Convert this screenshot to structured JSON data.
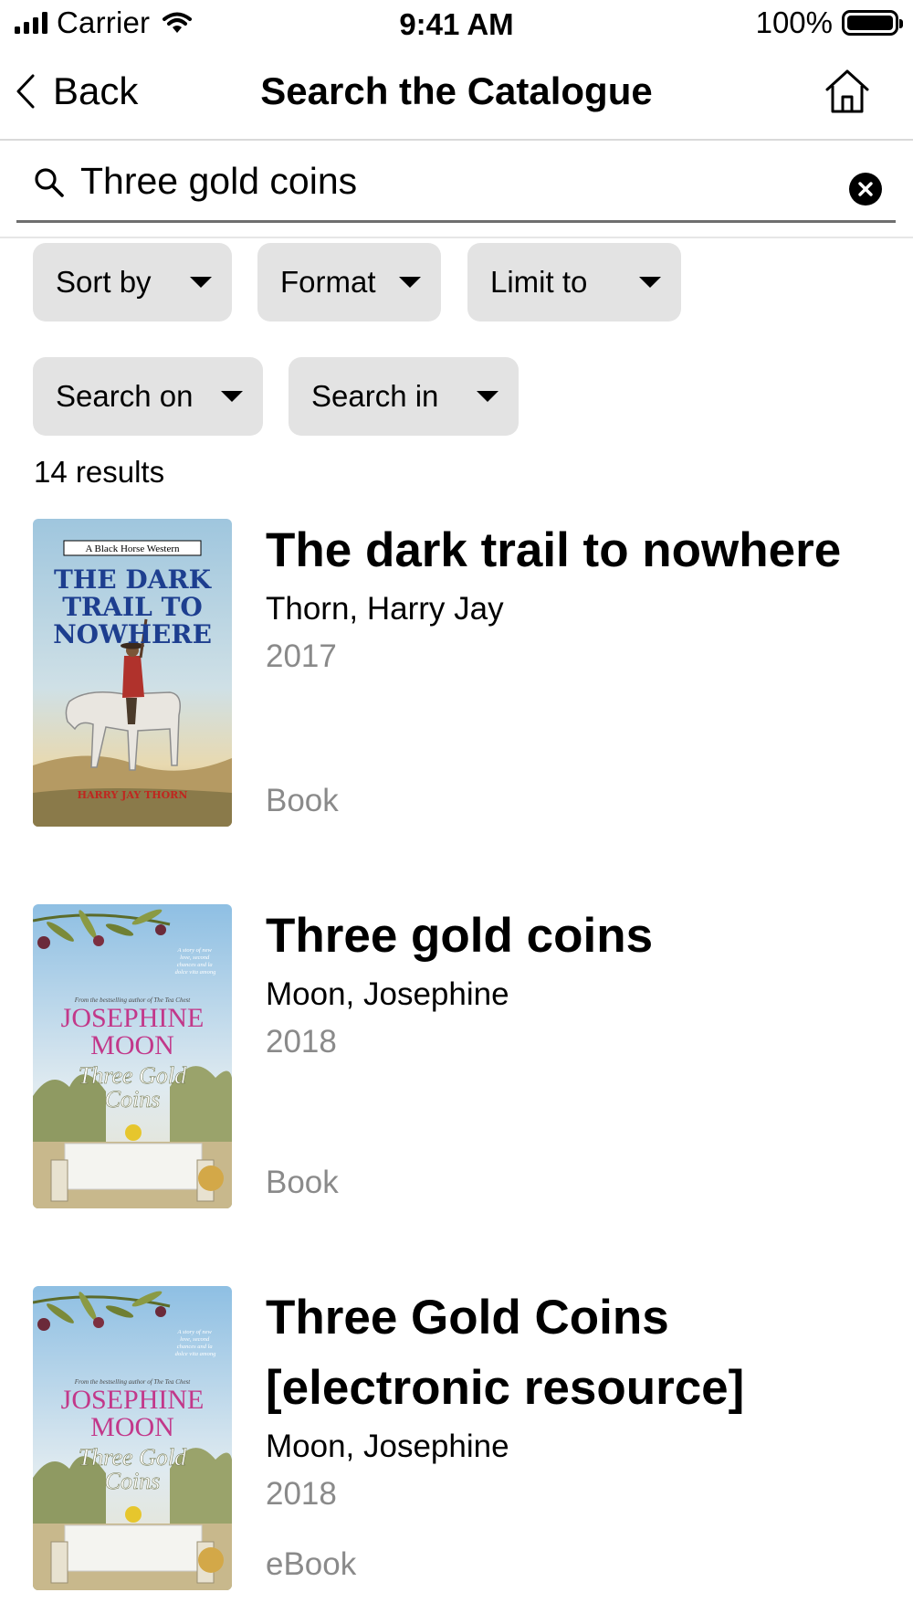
{
  "status_bar": {
    "carrier": "Carrier",
    "time": "9:41 AM",
    "battery": "100%"
  },
  "nav": {
    "back_label": "Back",
    "title": "Search the Catalogue",
    "home_icon": "home-icon"
  },
  "search": {
    "query": "Three gold coins",
    "clear_icon": "clear-icon"
  },
  "filters": {
    "sort_by": "Sort by",
    "format": "Format",
    "limit_to": "Limit to",
    "search_on": "Search on",
    "search_in": "Search in"
  },
  "results_count": "14 results",
  "results": [
    {
      "title": "The dark trail to nowhere",
      "author": "Thorn, Harry Jay",
      "year": "2017",
      "format": "Book",
      "cover": {
        "series": "A Black Horse Western",
        "title_lines": [
          "THE DARK",
          "TRAIL TO",
          "NOWHERE"
        ],
        "author": "HARRY JAY THORN"
      }
    },
    {
      "title": "Three gold coins",
      "author": "Moon, Josephine",
      "year": "2018",
      "format": "Book",
      "cover": {
        "tagline": "A story of new love, second chances and la dolce vita among the Tuscan hills",
        "byline": "From the bestselling author of The Tea Chest",
        "author_lines": [
          "JOSEPHINE",
          "MOON"
        ],
        "title_lines": [
          "Three Gold",
          "Coins"
        ]
      }
    },
    {
      "title": "Three Gold Coins [electronic resource]",
      "author": "Moon, Josephine",
      "year": "2018",
      "format": "eBook",
      "cover": {
        "tagline": "A story of new love, second chances and la dolce vita among the Tuscan hills",
        "byline": "From the bestselling author of The Tea Chest",
        "author_lines": [
          "JOSEPHINE",
          "MOON"
        ],
        "title_lines": [
          "Three Gold",
          "Coins"
        ]
      }
    }
  ]
}
